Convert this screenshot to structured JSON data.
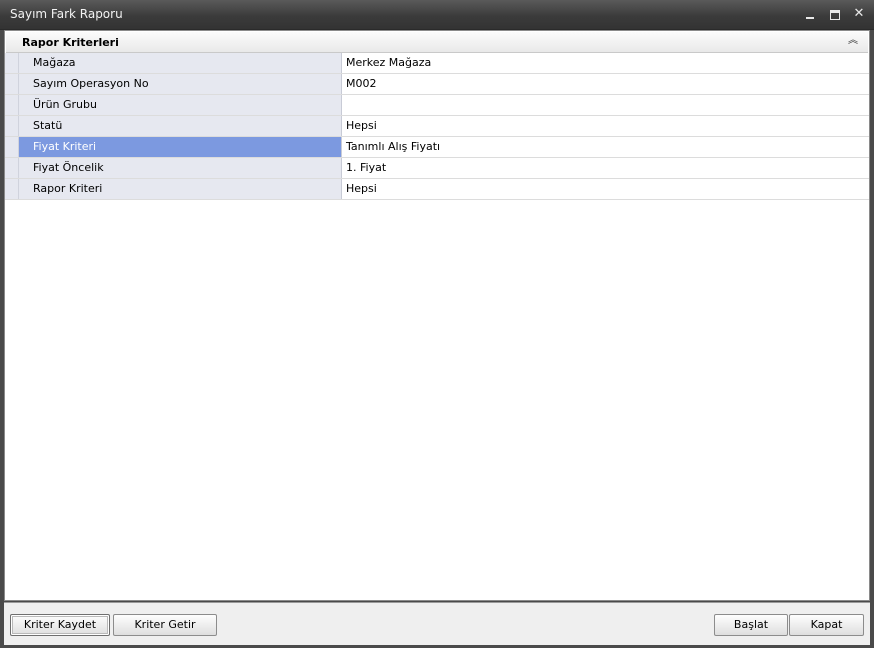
{
  "window": {
    "title": "Sayım Fark Raporu"
  },
  "criteria_group": {
    "title": "Rapor Kriterleri",
    "collapse_icon": "double-chevron-up-icon",
    "rows": [
      {
        "label": "Mağaza",
        "value": "Merkez Mağaza"
      },
      {
        "label": "Sayım Operasyon No",
        "value": "M002"
      },
      {
        "label": "Ürün Grubu",
        "value": ""
      },
      {
        "label": "Statü",
        "value": "Hepsi"
      },
      {
        "label": "Fiyat Kriteri",
        "value": "Tanımlı Alış Fiyatı",
        "selected": true
      },
      {
        "label": "Fiyat Öncelik",
        "value": "1. Fiyat"
      },
      {
        "label": "Rapor Kriteri",
        "value": "Hepsi"
      }
    ]
  },
  "buttons": {
    "save_criteria": "Kriter Kaydet",
    "load_criteria": "Kriter Getir",
    "start": "Başlat",
    "close": "Kapat"
  },
  "colors": {
    "selected_row": "#7c99e0",
    "label_background": "#e6e8f0"
  }
}
